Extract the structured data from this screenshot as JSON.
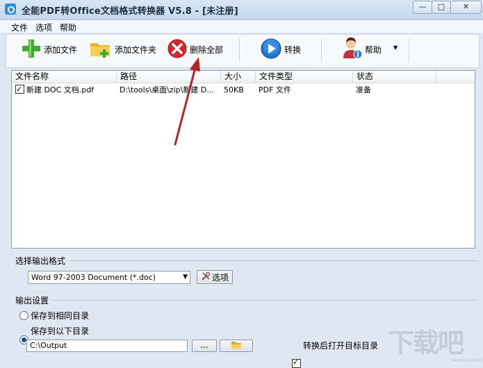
{
  "window": {
    "title": "全能PDF转Office文档格式转换器 V5.8  -  [未注册]",
    "min_glyph": "—",
    "max_glyph": "□",
    "close_glyph": "✕"
  },
  "menu": [
    "文件",
    "选项",
    "帮助"
  ],
  "toolbar": {
    "add_file": "添加文件",
    "add_folder": "添加文件夹",
    "delete_all": "删除全部",
    "convert": "转换",
    "help": "帮助"
  },
  "list": {
    "columns": [
      "文件名称",
      "路径",
      "大小",
      "文件类型",
      "状态"
    ],
    "rows": [
      {
        "checked": true,
        "name": "新建 DOC 文档.pdf",
        "path": "D:\\tools\\桌面\\zip\\新建 D...",
        "size": "50KB",
        "type": "PDF 文件",
        "status": "准备"
      }
    ]
  },
  "output_format": {
    "group_title": "选择输出格式",
    "selected": "Word 97-2003 Document (*.doc)",
    "options_button": "选项"
  },
  "output_settings": {
    "group_title": "输出设置",
    "radio_same_dir": "保存到相同目录",
    "radio_below_dir": "保存到以下目录",
    "selected_radio": "below",
    "path_value": "C:\\Output",
    "browse_button": "...",
    "open_after_label": "转换后打开目标目录",
    "open_after_checked": true
  },
  "watermark": {
    "text": "下载吧",
    "sub": "www.xiazaiba.com"
  }
}
